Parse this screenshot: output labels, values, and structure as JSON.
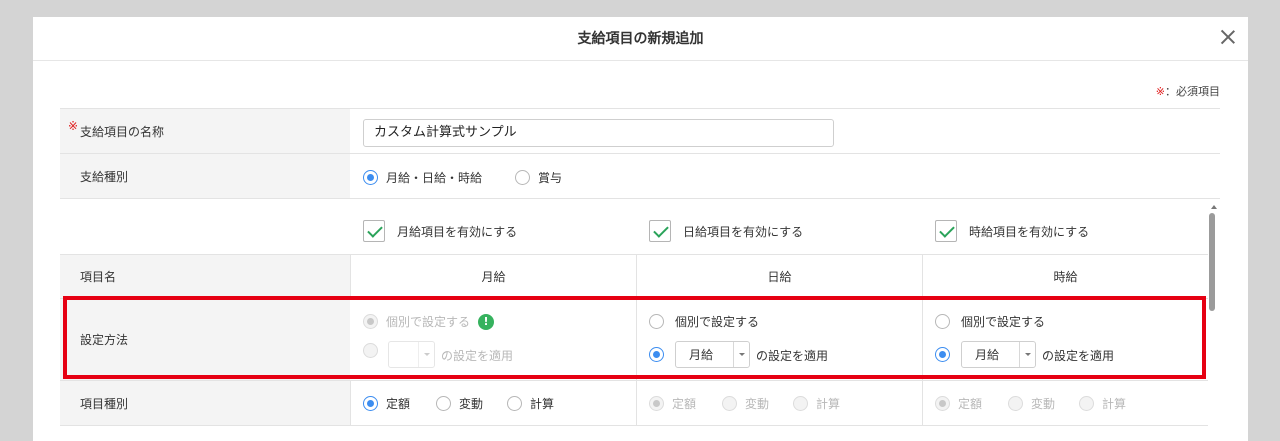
{
  "dialog": {
    "title": "支給項目の新規追加",
    "required_mark": "※",
    "required_text": "：必須項目"
  },
  "name_row": {
    "required": "※",
    "label": "支給項目の名称",
    "value": "カスタム計算式サンプル"
  },
  "type_row": {
    "label": "支給種別",
    "options": [
      {
        "label": "月給・日給・時給",
        "selected": true
      },
      {
        "label": "賞与",
        "selected": false
      }
    ]
  },
  "enable": [
    {
      "label": "月給項目を有効にする",
      "checked": true
    },
    {
      "label": "日給項目を有効にする",
      "checked": true
    },
    {
      "label": "時給項目を有効にする",
      "checked": true
    }
  ],
  "columns": {
    "item_name": "項目名",
    "monthly": "月給",
    "daily": "日給",
    "hourly": "時給"
  },
  "method_row": {
    "label": "設定方法",
    "monthly": {
      "individual": "個別で設定する",
      "apply_suffix": "の設定を適用",
      "select_value": "",
      "warning": "!"
    },
    "daily": {
      "individual": "個別で設定する",
      "apply_suffix": "の設定を適用",
      "select_value": "月給"
    },
    "hourly": {
      "individual": "個別で設定する",
      "apply_suffix": "の設定を適用",
      "select_value": "月給"
    }
  },
  "kind_row": {
    "label": "項目種別",
    "options": [
      "定額",
      "変動",
      "計算"
    ],
    "selected": "定額"
  },
  "colors": {
    "accent": "#3c8df0",
    "check": "#2aa35a",
    "required": "#e02020",
    "highlight": "#e60012"
  }
}
